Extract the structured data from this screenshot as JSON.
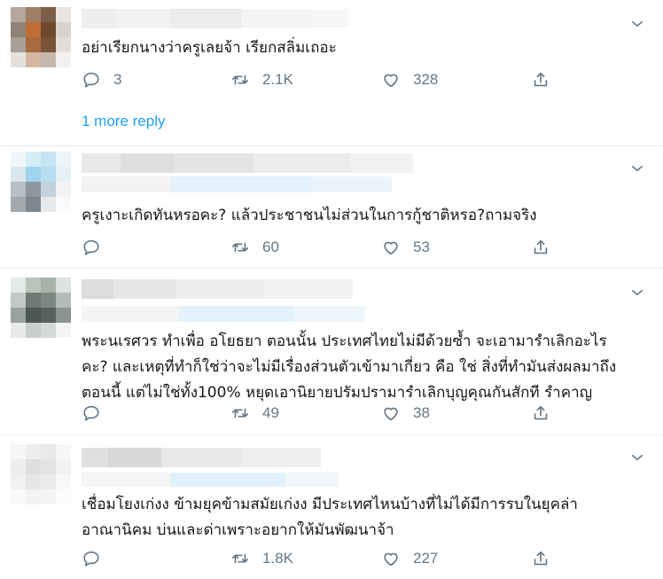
{
  "tweets": [
    {
      "text_lines": [
        "อย่าเรียกนางว่าครูเลยจ้า เรียกสลิ่มเถอะ"
      ],
      "replies": "3",
      "retweets": "2.1K",
      "likes": "328",
      "more_replies": "1 more reply"
    },
    {
      "text_lines": [
        "ครูเงาะเกิดทันหรอคะ? แล้วประชาชนไม่ส่วนในการกู้ชาติหรอ?ถามจริง"
      ],
      "replies": "",
      "retweets": "60",
      "likes": "53"
    },
    {
      "text_lines": [
        "พระนเรศวร ทำเพื่อ อโยธยา ตอนนั้น ประเทศไทยไม่มีด้วยซ้ำ จะเอามารำเลิกอะไร",
        "คะ? และเหตุที่ทำก็ใช่ว่าจะไม่มีเรื่องส่วนตัวเข้ามาเกี่ยว คือ ใช่ สิ่งที่ทำมันส่งผลมาถึง",
        "ตอนนี้ แต่ไม่ใช่ทั้ง100% หยุดเอานิยายปรัมปรามารำเลิกบุญคุณกันสักที รำคาญ"
      ],
      "replies": "",
      "retweets": "49",
      "likes": "38"
    },
    {
      "text_lines": [
        "เชื่อมโยงเก่งง ข้ามยุคข้ามสมัยเก่งง มีประเทศไหนบ้างที่ไม่ได้มีการรบในยุคล่า",
        "อาณานิคม บ่นและด่าเพราะอยากให้มันพัฒนาจ้า"
      ],
      "replies": "",
      "retweets": "1.8K",
      "likes": "227"
    }
  ],
  "icons": {
    "reply": "reply-icon",
    "retweet": "retweet-icon",
    "like": "heart-icon",
    "share": "share-icon",
    "caret": "chevron-down-icon"
  },
  "colors": {
    "text": "#14171a",
    "muted": "#657786",
    "link": "#1da1f2",
    "divider": "#e6ecf0"
  }
}
